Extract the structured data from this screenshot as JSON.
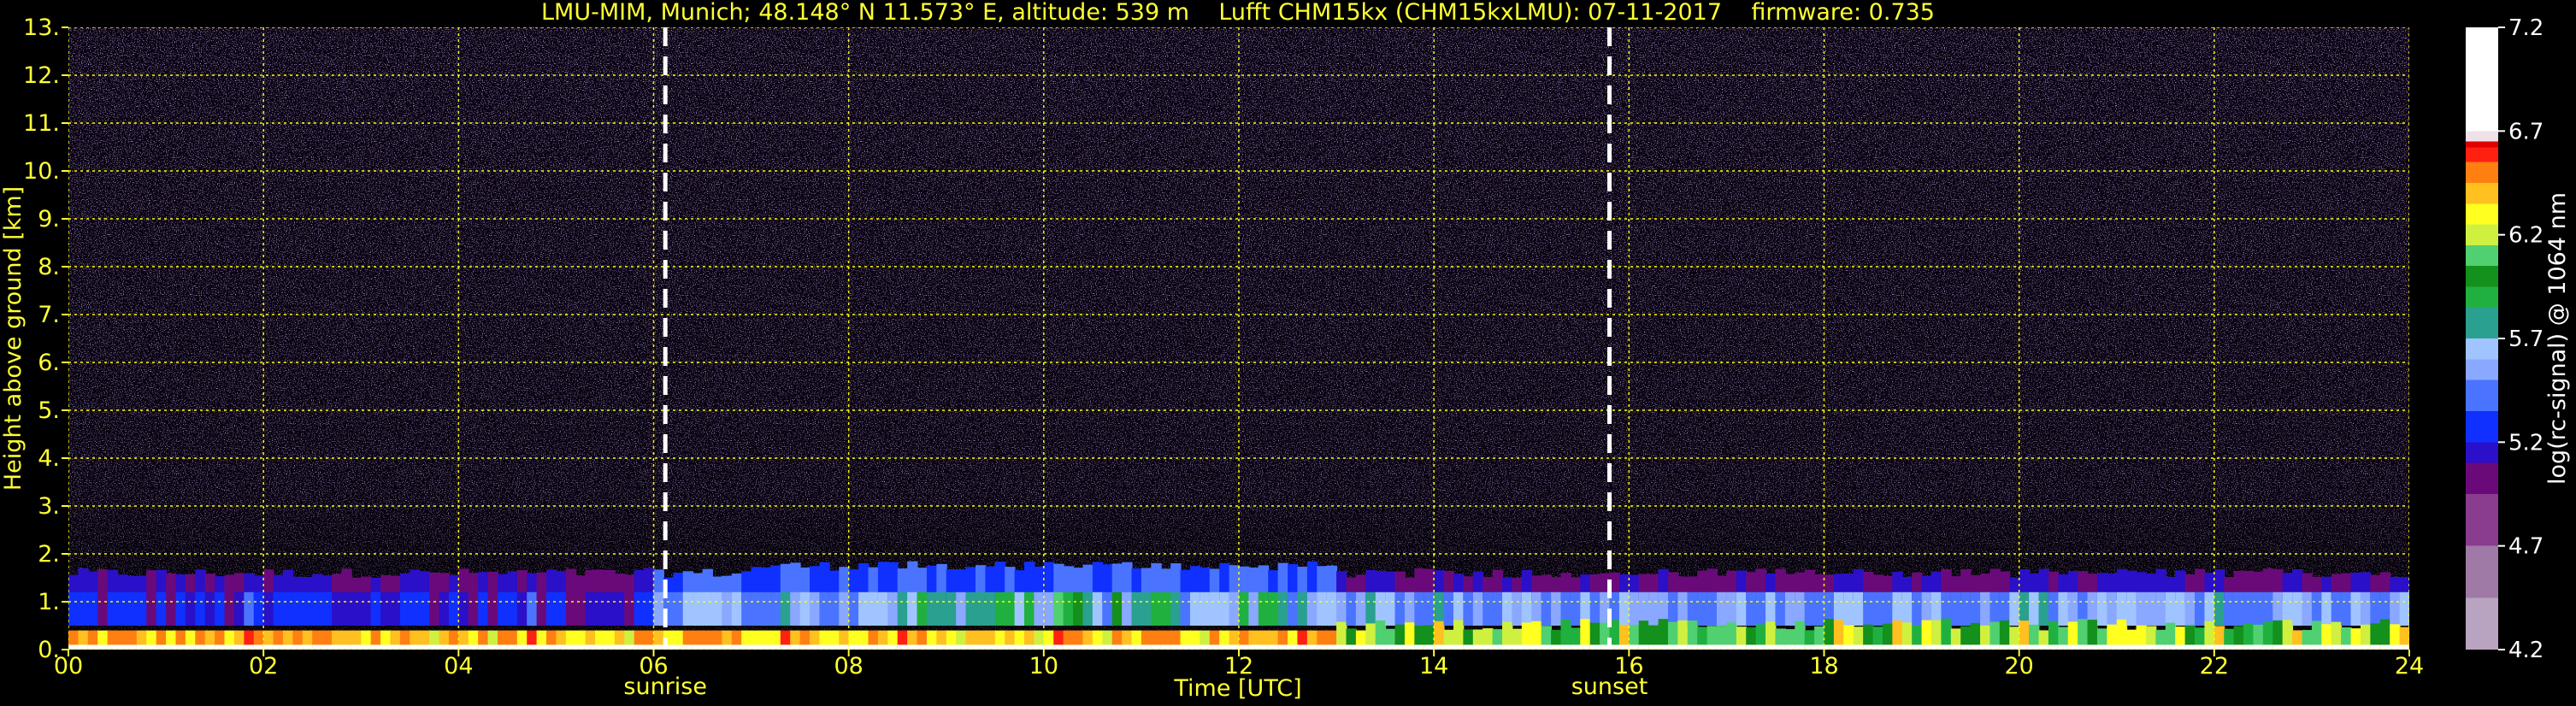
{
  "chart_data": {
    "type": "heatmap",
    "title": "LMU-MIM, Munich; 48.148° N 11.573° E, altitude: 539 m    Lufft CHM15kx (CHM15kxLMU): 07-11-2017    firmware: 0.735",
    "xlabel": "Time [UTC]",
    "ylabel": "Height above ground [km]",
    "colorbar_label": "log(rc-signal) @ 1064 nm",
    "xlim": [
      0,
      24
    ],
    "ylim": [
      0,
      13
    ],
    "x_ticks": [
      0,
      2,
      4,
      6,
      8,
      10,
      12,
      14,
      16,
      18,
      20,
      22,
      24
    ],
    "x_tick_labels": [
      "00",
      "02",
      "04",
      "06",
      "08",
      "10",
      "12",
      "14",
      "16",
      "18",
      "20",
      "22",
      "24"
    ],
    "y_ticks": [
      0,
      1,
      2,
      3,
      4,
      5,
      6,
      7,
      8,
      9,
      10,
      11,
      12,
      13
    ],
    "y_tick_labels": [
      "0.",
      "1.",
      "2.",
      "3.",
      "4.",
      "5.",
      "6.",
      "7.",
      "8.",
      "9.",
      "10.",
      "11.",
      "12.",
      "13."
    ],
    "grid": true,
    "colorbar": {
      "ticks": [
        4.2,
        4.7,
        5.2,
        5.7,
        6.2,
        6.7,
        7.2
      ],
      "tick_labels": [
        "4.2",
        "4.7",
        "5.2",
        "5.7",
        "6.2",
        "6.7",
        "7.2"
      ],
      "range": [
        4.2,
        7.2
      ],
      "stops": [
        {
          "v": 4.2,
          "color": "#b8a4c0"
        },
        {
          "v": 4.45,
          "color": "#a07aa6"
        },
        {
          "v": 4.7,
          "color": "#8a3c8e"
        },
        {
          "v": 4.95,
          "color": "#6a0a7a"
        },
        {
          "v": 5.1,
          "color": "#2a10c8"
        },
        {
          "v": 5.2,
          "color": "#1030ff"
        },
        {
          "v": 5.35,
          "color": "#4a74ff"
        },
        {
          "v": 5.5,
          "color": "#8aa8ff"
        },
        {
          "v": 5.6,
          "color": "#a0c4ff"
        },
        {
          "v": 5.7,
          "color": "#2aa090"
        },
        {
          "v": 5.85,
          "color": "#20b040"
        },
        {
          "v": 5.95,
          "color": "#14901c"
        },
        {
          "v": 6.05,
          "color": "#50d070"
        },
        {
          "v": 6.15,
          "color": "#d0f040"
        },
        {
          "v": 6.25,
          "color": "#ffff20"
        },
        {
          "v": 6.35,
          "color": "#ffc020"
        },
        {
          "v": 6.45,
          "color": "#ff8010"
        },
        {
          "v": 6.55,
          "color": "#ff2010"
        },
        {
          "v": 6.62,
          "color": "#e00000"
        },
        {
          "v": 6.65,
          "color": "#f0e0e8"
        },
        {
          "v": 6.7,
          "color": "#ffffff"
        },
        {
          "v": 7.2,
          "color": "#ffffff"
        }
      ]
    },
    "annotations": [
      {
        "x": 6.12,
        "label": "sunrise",
        "style": "dashed-white-vertical"
      },
      {
        "x": 15.8,
        "label": "sunset",
        "style": "dashed-white-vertical"
      }
    ],
    "layers": [
      {
        "name": "noise",
        "y_range": [
          1.8,
          13
        ],
        "value": 4.5
      },
      {
        "name": "aerosol-layer-top",
        "y_range": [
          1.0,
          1.6
        ],
        "value": 5.1
      },
      {
        "name": "aerosol-layer-core",
        "y_range": [
          0.5,
          1.2
        ],
        "value": 5.5
      },
      {
        "name": "near-ground",
        "y_range": [
          0.0,
          0.4
        ],
        "value": 6.3
      }
    ],
    "colors": {
      "text": "#ffff33",
      "grid": "#ffff00",
      "background": "#000000",
      "annotation_line": "#ffffff"
    }
  }
}
